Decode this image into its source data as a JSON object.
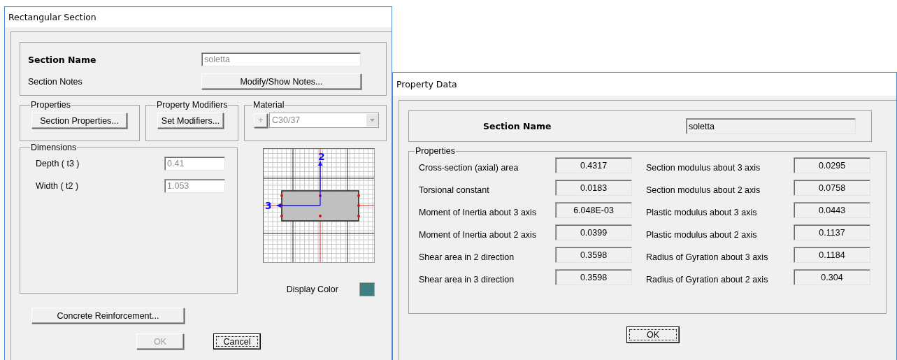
{
  "left_dialog": {
    "title": "Rectangular Section",
    "section_name": {
      "label": "Section Name",
      "value": "soletta",
      "disabled": true
    },
    "section_notes": {
      "label": "Section Notes",
      "button": "Modify/Show Notes..."
    },
    "properties_group": {
      "title": "Properties",
      "button": "Section Properties..."
    },
    "modifiers_group": {
      "title": "Property Modifiers",
      "button": "Set Modifiers..."
    },
    "material_group": {
      "title": "Material",
      "add_button": "+",
      "value": "C30/37",
      "disabled": true
    },
    "dimensions": {
      "title": "Dimensions",
      "fields": [
        {
          "label": "Depth  ( t3 )",
          "value": "0.41",
          "disabled": true
        },
        {
          "label": "Width  ( t2 )",
          "value": "1.053",
          "disabled": true
        }
      ]
    },
    "preview": {
      "vertical_axis": "2",
      "horizontal_axis": "3"
    },
    "display_color": {
      "label": "Display Color",
      "color": "#3f7f7f"
    },
    "reinforcement_button": "Concrete Reinforcement...",
    "buttons": [
      {
        "label": "OK",
        "disabled": true,
        "focused": false
      },
      {
        "label": "Cancel",
        "disabled": false,
        "focused": true
      }
    ]
  },
  "right_dialog": {
    "title": "Property Data",
    "section_name": {
      "label": "Section Name",
      "value": "soletta"
    },
    "properties": {
      "title": "Properties",
      "left_column": [
        {
          "label": "Cross-section (axial) area",
          "value": "0.4317"
        },
        {
          "label": "Torsional constant",
          "value": "0.0183"
        },
        {
          "label": "Moment of Inertia about 3 axis",
          "value": "6.048E-03"
        },
        {
          "label": "Moment of Inertia about 2 axis",
          "value": "0.0399"
        },
        {
          "label": "Shear area in 2 direction",
          "value": "0.3598"
        },
        {
          "label": "Shear area in 3 direction",
          "value": "0.3598"
        }
      ],
      "right_column": [
        {
          "label": "Section modulus about 3 axis",
          "value": "0.0295"
        },
        {
          "label": "Section modulus about 2 axis",
          "value": "0.0758"
        },
        {
          "label": "Plastic modulus about 3 axis",
          "value": "0.0443"
        },
        {
          "label": "Plastic modulus about 2 axis",
          "value": "0.1137"
        },
        {
          "label": "Radius of Gyration about 3 axis",
          "value": "0.1184"
        },
        {
          "label": "Radius of Gyration about 2 axis",
          "value": "0.304"
        }
      ]
    },
    "ok_button": {
      "label": "OK",
      "focused": true
    }
  }
}
